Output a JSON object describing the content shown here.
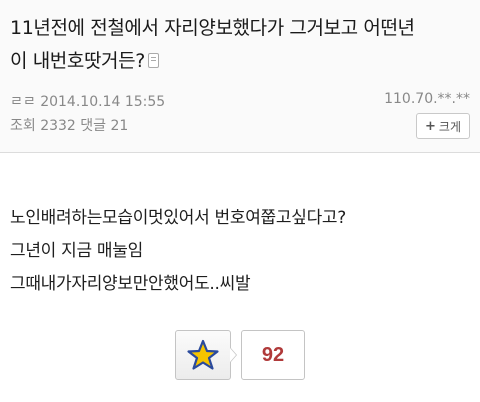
{
  "post": {
    "title_line1": "11년전에 전철에서 자리양보했다가 그거보고 어떤년",
    "title_line2": "이 내번호땃거든?",
    "author": "ㄹㄹ 2014.10.14 15:55",
    "ip": "110.70.**.**",
    "stats": "조회 2332 댓글 21",
    "enlarge_label": "크게"
  },
  "body": {
    "lines": [
      "노인배려하는모습이멋있어서 번호여쭙고싶다고?",
      "그년이 지금 매눌임",
      "그때내가자리양보만안했어도..씨발"
    ]
  },
  "recommend": {
    "count": "92"
  },
  "colors": {
    "count_red": "#b03a3a",
    "star_yellow": "#f5c400",
    "star_outline": "#2a4a9c"
  }
}
